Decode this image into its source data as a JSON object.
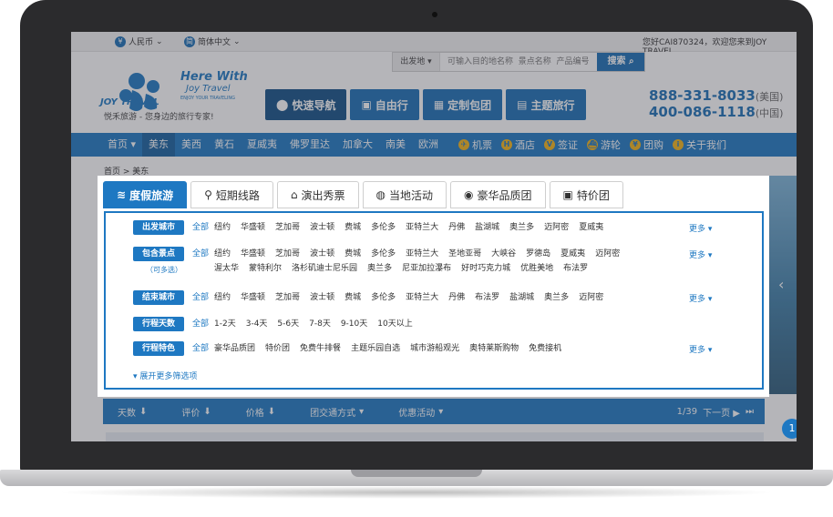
{
  "topbar": {
    "currency": "人民币",
    "language": "简体中文",
    "welcome": "您好CAI870324，欢迎您来到JOY TRAVEL",
    "currency_icon": "¥",
    "language_icon": "简"
  },
  "search": {
    "location_label": "出发地",
    "placeholder": "可输入目的地名称  景点名称  产品编号",
    "button": "搜索"
  },
  "logo": {
    "brand": "JOY TRAVEL",
    "tagline_en1": "Here With",
    "tagline_en2": "Joy Travel",
    "tagline_en3": "ENJOY YOUR TRAVELING",
    "slogan": "悦禾旅游 - 您身边的旅行专家!"
  },
  "nav_tabs": [
    {
      "label": "快速导航",
      "icon": "location-pin-icon"
    },
    {
      "label": "自由行",
      "icon": "briefcase-icon"
    },
    {
      "label": "定制包团",
      "icon": "puzzle-icon"
    },
    {
      "label": "主题旅行",
      "icon": "camera-icon"
    }
  ],
  "phones": [
    {
      "number": "888-331-8033",
      "region": "(美国)"
    },
    {
      "number": "400-086-1118",
      "region": "(中国)"
    }
  ],
  "main_nav": {
    "items": [
      "首页",
      "美东",
      "美西",
      "黄石",
      "夏威夷",
      "佛罗里达",
      "加拿大",
      "南美",
      "欧洲"
    ],
    "right": [
      "机票",
      "酒店",
      "签证",
      "游轮",
      "团购",
      "关于我们"
    ]
  },
  "breadcrumb": "首页 > 美东",
  "tabs": [
    "度假旅游",
    "短期线路",
    "演出秀票",
    "当地活动",
    "豪华品质团",
    "特价团"
  ],
  "filters": {
    "all_label": "全部",
    "more_label": "更多",
    "expand_label": "展开更多筛选项",
    "rows": [
      {
        "label": "出发城市",
        "sub": "",
        "options": [
          "纽约",
          "华盛顿",
          "芝加哥",
          "波士顿",
          "费城",
          "多伦多",
          "亚特兰大",
          "丹佛",
          "盐湖城",
          "奥兰多",
          "迈阿密",
          "夏威夷"
        ]
      },
      {
        "label": "包含景点",
        "sub": "（可多选）",
        "options": [
          "纽约",
          "华盛顿",
          "芝加哥",
          "波士顿",
          "费城",
          "多伦多",
          "亚特兰大",
          "圣地亚哥",
          "大峡谷",
          "罗德岛",
          "夏威夷",
          "迈阿密",
          "渥太华",
          "蒙特利尔",
          "洛杉矶迪士尼乐园",
          "奥兰多",
          "尼亚加拉瀑布",
          "好时巧克力城",
          "优胜美地",
          "布法罗"
        ]
      },
      {
        "label": "结束城市",
        "sub": "",
        "options": [
          "纽约",
          "华盛顿",
          "芝加哥",
          "波士顿",
          "费城",
          "多伦多",
          "亚特兰大",
          "丹佛",
          "布法罗",
          "盐湖城",
          "奥兰多",
          "迈阿密"
        ]
      },
      {
        "label": "行程天数",
        "sub": "",
        "options": [
          "1-2天",
          "3-4天",
          "5-6天",
          "7-8天",
          "9-10天",
          "10天以上"
        ]
      },
      {
        "label": "行程特色",
        "sub": "",
        "options": [
          "豪华品质团",
          "特价团",
          "免费牛排餐",
          "主题乐园自选",
          "城市游船观光",
          "奥特莱斯购物",
          "免费接机"
        ]
      }
    ]
  },
  "sortbar": {
    "items": [
      "天数",
      "评价",
      "价格",
      "团交通方式",
      "优惠活动"
    ],
    "page": "1/39",
    "next": "下一页"
  },
  "bubble": "1"
}
